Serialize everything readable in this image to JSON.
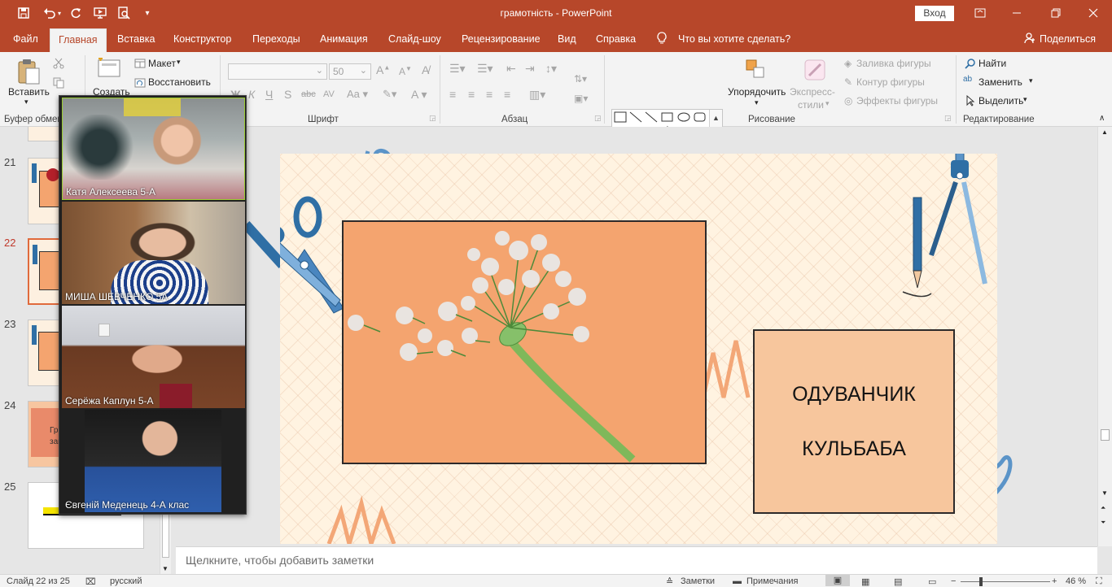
{
  "window": {
    "title": "грамотність  -  PowerPoint",
    "sign_in": "Вход"
  },
  "tabs": [
    "Файл",
    "Главная",
    "Вставка",
    "Конструктор",
    "Переходы",
    "Анимация",
    "Слайд-шоу",
    "Рецензирование",
    "Вид",
    "Справка"
  ],
  "tell_me": "Что вы хотите сделать?",
  "share": "Поделиться",
  "ribbon": {
    "clipboard": {
      "paste": "Вставить",
      "label": "Буфер обмена"
    },
    "slides": {
      "new_slide": "Создать",
      "layout": "Макет",
      "reset": "Восстановить"
    },
    "font": {
      "font_size": "50",
      "label": "Шрифт"
    },
    "paragraph": {
      "label": "Абзац"
    },
    "drawing": {
      "arrange": "Упорядочить",
      "quick_styles_1": "Экспресс-",
      "quick_styles_2": "стили",
      "fill": "Заливка фигуры",
      "outline": "Контур фигуры",
      "effects": "Эффекты фигуры",
      "label": "Рисование"
    },
    "editing": {
      "find": "Найти",
      "replace": "Заменить",
      "select": "Выделить",
      "label": "Редактирование"
    }
  },
  "thumbnails": [
    {
      "number": "21"
    },
    {
      "number": "22"
    },
    {
      "number": "23"
    },
    {
      "number": "24"
    },
    {
      "number": "25"
    }
  ],
  "thumb24_text_1": "Гр",
  "thumb24_text_2": "зав",
  "slide": {
    "word1": "ОДУВАНЧИК",
    "word2": "КУЛЬБАБА"
  },
  "notes_placeholder": "Щелкните, чтобы добавить заметки",
  "status": {
    "slide_info": "Слайд 22 из 25",
    "language": "русский",
    "notes": "Заметки",
    "comments": "Примечания",
    "zoom": "46 %"
  },
  "participants": [
    {
      "name": "Катя Алексеева 5-А"
    },
    {
      "name": "МИША ШЕВЧЕНКО 5А"
    },
    {
      "name": "Серёжа Каплун 5-А"
    },
    {
      "name": "Євгеній Меденець 4-А клас"
    }
  ],
  "colors": {
    "accent": "#b7472a",
    "slide_bg": "#fff3e1",
    "photo_bg": "#f4a46f",
    "box_bg": "#f7c69d",
    "scissors": "#2f6fa5"
  }
}
